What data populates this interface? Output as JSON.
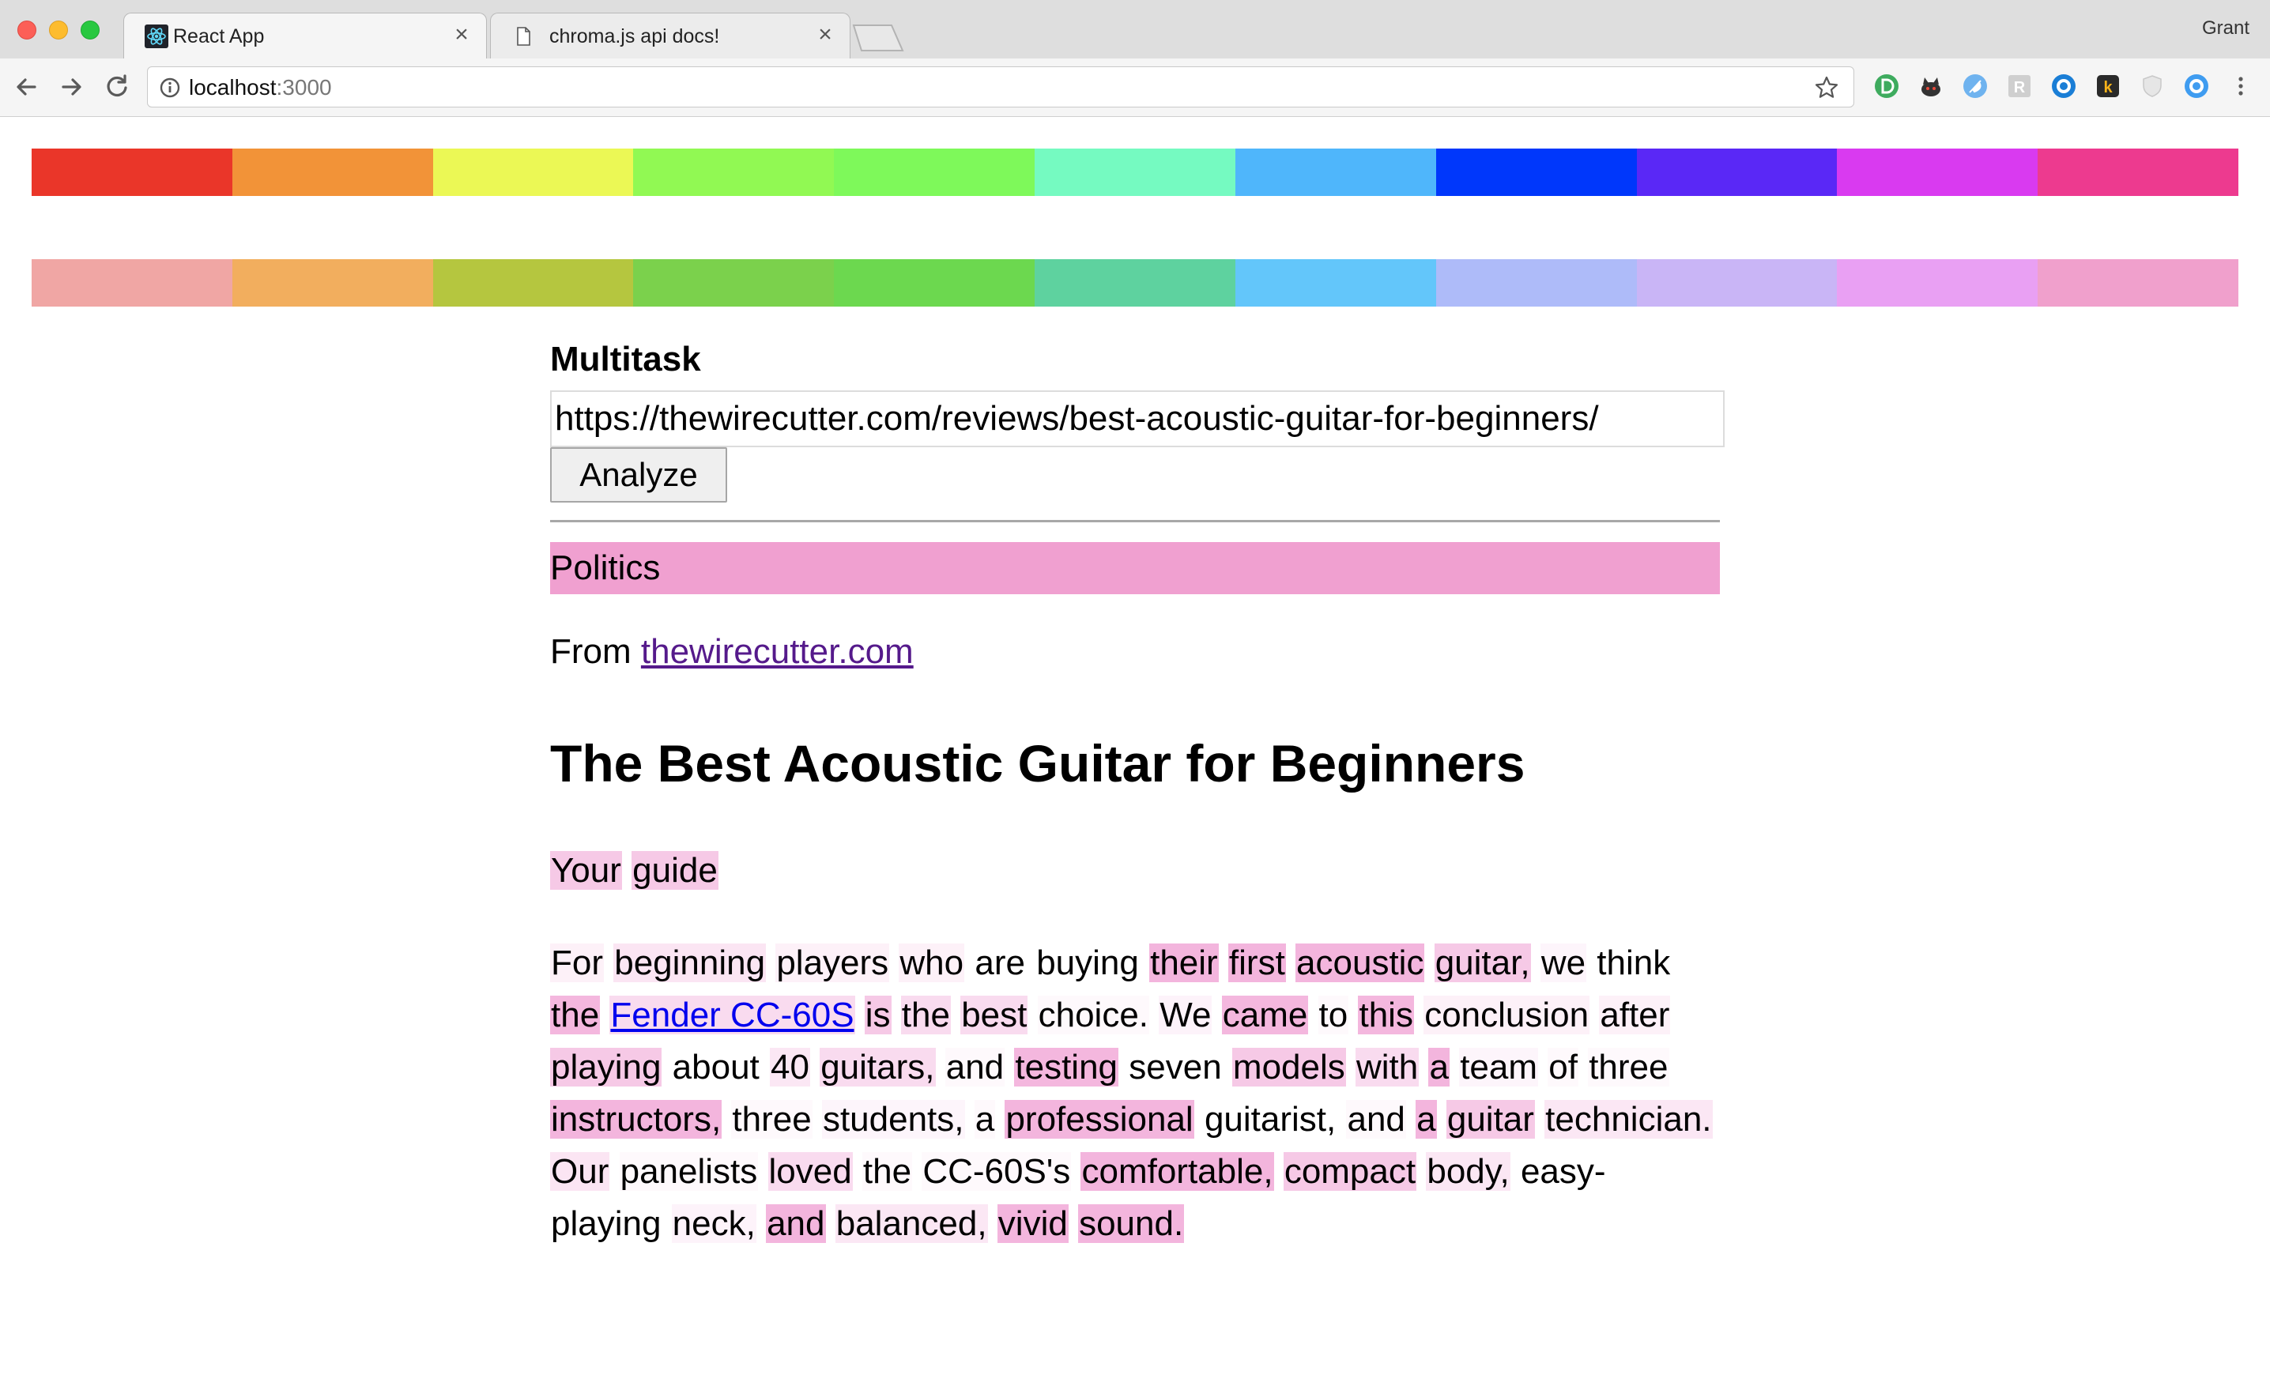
{
  "browser": {
    "tabs": [
      {
        "title": "React App",
        "active": true
      },
      {
        "title": "chroma.js api docs!",
        "active": false
      }
    ],
    "profile_name": "Grant",
    "address": {
      "host": "localhost",
      "port": ":3000"
    },
    "extension_icons": [
      "green-d-extension-icon",
      "cat-extension-icon",
      "blue-feather-extension-icon",
      "gray-r-extension-icon",
      "blue-ring-extension-icon",
      "k-extension-icon",
      "shield-extension-icon",
      "light-blue-ring-extension-icon"
    ]
  },
  "palette": {
    "saturated": [
      "#ea3629",
      "#f29338",
      "#ebf855",
      "#91f953",
      "#7ef95a",
      "#75fac1",
      "#4fb6fb",
      "#0037fb",
      "#5a28f6",
      "#d93af0",
      "#ed3a8f"
    ],
    "muted": [
      "#f0a6a4",
      "#f2ae5e",
      "#b5c63f",
      "#7bd14c",
      "#6cd84f",
      "#5ed29f",
      "#63c6fa",
      "#aebbf9",
      "#c9b5f6",
      "#e9a0f3",
      "#f0a0cc"
    ]
  },
  "app": {
    "title": "Multitask",
    "url_value": "https://thewirecutter.com/reviews/best-acoustic-guitar-for-beginners/",
    "analyze_label": "Analyze",
    "category": {
      "label": "Politics",
      "color": "#f0a0d0"
    },
    "source_prefix": "From ",
    "source_link": "thewirecutter.com",
    "article_title": "The Best Acoustic Guitar for Beginners",
    "lede": [
      {
        "text": "Your",
        "weight": 0.45
      },
      {
        "text": "guide",
        "weight": 0.45
      }
    ],
    "body_lines": [
      [
        {
          "text": "For",
          "weight": 0.12
        },
        {
          "text": "beginning",
          "weight": 0.22
        },
        {
          "text": "players",
          "weight": 0.12
        },
        {
          "text": "who",
          "weight": 0.12
        },
        {
          "text": "are",
          "weight": 0
        },
        {
          "text": "buying",
          "weight": 0
        },
        {
          "text": "their",
          "weight": 0.62
        },
        {
          "text": "first",
          "weight": 0.62
        },
        {
          "text": "acoustic",
          "weight": 0.62
        },
        {
          "text": "guitar,",
          "weight": 0.45
        },
        {
          "text": "we",
          "weight": 0.08
        },
        {
          "text": "think",
          "weight": 0
        }
      ],
      [
        {
          "text": "the",
          "weight": 0.6
        },
        {
          "text": "Fender CC-60S",
          "weight": 0.3,
          "link": true
        },
        {
          "text": "is",
          "weight": 0.45
        },
        {
          "text": "the",
          "weight": 0.3
        },
        {
          "text": "best",
          "weight": 0.3
        },
        {
          "text": "choice.",
          "weight": 0.05
        },
        {
          "text": "We",
          "weight": 0.1
        },
        {
          "text": "came",
          "weight": 0.6
        },
        {
          "text": "to",
          "weight": 0.05
        },
        {
          "text": "this",
          "weight": 0.6
        },
        {
          "text": "conclusion",
          "weight": 0.12
        },
        {
          "text": "after",
          "weight": 0.12
        }
      ],
      [
        {
          "text": "playing",
          "weight": 0.45
        },
        {
          "text": "about",
          "weight": 0
        },
        {
          "text": "40",
          "weight": 0.2
        },
        {
          "text": "guitars,",
          "weight": 0.3
        },
        {
          "text": "and",
          "weight": 0.05
        },
        {
          "text": "testing",
          "weight": 0.6
        },
        {
          "text": "seven",
          "weight": 0
        },
        {
          "text": "models",
          "weight": 0.45
        },
        {
          "text": "with",
          "weight": 0.3
        },
        {
          "text": "a",
          "weight": 0.62
        },
        {
          "text": "team",
          "weight": 0.08
        },
        {
          "text": "of",
          "weight": 0.05
        },
        {
          "text": "three",
          "weight": 0.05
        }
      ],
      [
        {
          "text": "instructors,",
          "weight": 0.62
        },
        {
          "text": "three",
          "weight": 0.05
        },
        {
          "text": "students,",
          "weight": 0.08
        },
        {
          "text": "a",
          "weight": 0.05
        },
        {
          "text": "professional",
          "weight": 0.62
        },
        {
          "text": "guitarist,",
          "weight": 0
        },
        {
          "text": "and",
          "weight": 0.05
        },
        {
          "text": "a",
          "weight": 0.62
        },
        {
          "text": "guitar",
          "weight": 0.45
        },
        {
          "text": "technician.",
          "weight": 0.2
        }
      ],
      [
        {
          "text": "Our",
          "weight": 0.22
        },
        {
          "text": "panelists",
          "weight": 0.05
        },
        {
          "text": "loved",
          "weight": 0.3
        },
        {
          "text": "the",
          "weight": 0.05
        },
        {
          "text": "CC-60S's",
          "weight": 0.05
        },
        {
          "text": "comfortable,",
          "weight": 0.62
        },
        {
          "text": "compact",
          "weight": 0.45
        },
        {
          "text": "body,",
          "weight": 0.2
        },
        {
          "text": "easy-",
          "weight": 0
        }
      ],
      [
        {
          "text": "playing",
          "weight": 0
        },
        {
          "text": "neck,",
          "weight": 0.1
        },
        {
          "text": "and",
          "weight": 0.62
        },
        {
          "text": "balanced,",
          "weight": 0.2
        },
        {
          "text": "vivid",
          "weight": 0.62
        },
        {
          "text": "sound.",
          "weight": 0.62
        }
      ]
    ]
  }
}
